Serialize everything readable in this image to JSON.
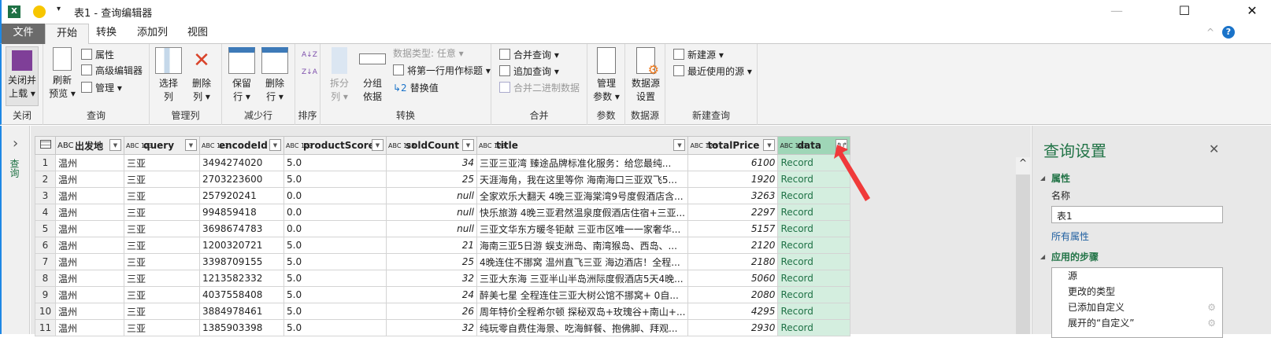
{
  "window": {
    "title": "表1 - 查询编辑器",
    "minimize": "—",
    "maximize": "☐",
    "close": "✕"
  },
  "tabs": [
    {
      "label": "文件"
    },
    {
      "label": "开始"
    },
    {
      "label": "转换"
    },
    {
      "label": "添加列"
    },
    {
      "label": "视图"
    }
  ],
  "ribbon": {
    "close_group": {
      "label": "关闭",
      "btn1": "关闭并",
      "btn2": "上载 ▾"
    },
    "query_group": {
      "label": "查询",
      "refresh1": "刷新",
      "refresh2": "预览 ▾",
      "properties": "属性",
      "advanced": "高级编辑器",
      "manage": "管理 ▾"
    },
    "cols_group": {
      "label": "管理列",
      "choose1": "选择",
      "choose2": "列",
      "remove1": "删除",
      "remove2": "列 ▾"
    },
    "rows_group": {
      "label": "减少行",
      "keep1": "保留",
      "keep2": "行 ▾",
      "remove1": "删除",
      "remove2": "行 ▾"
    },
    "sort_group": {
      "label": "排序",
      "asc": "A↓Z",
      "desc": "Z↓A"
    },
    "transform_group": {
      "label": "转换",
      "split1": "拆分",
      "split2": "列 ▾",
      "group1": "分组",
      "group2": "依据",
      "datatype": "数据类型: 任意 ▾",
      "firstrow": "将第一行用作标题 ▾",
      "replace": "替换值"
    },
    "combine_group": {
      "label": "合并",
      "merge": "合并查询 ▾",
      "append": "追加查询 ▾",
      "binary": "合并二进制数据"
    },
    "params_group": {
      "label": "参数",
      "manage1": "管理",
      "manage2": "参数 ▾"
    },
    "source_group": {
      "label": "数据源",
      "settings1": "数据源",
      "settings2": "设置"
    },
    "newquery_group": {
      "label": "新建查询",
      "newsource": "新建源 ▾",
      "recent": "最近使用的源 ▾"
    }
  },
  "leftnav": {
    "label": "查询",
    "expand": "›"
  },
  "table": {
    "columns": [
      {
        "name": "出发地",
        "type": "ABC"
      },
      {
        "name": "query",
        "type": "ABC 123"
      },
      {
        "name": "encodeId",
        "type": "ABC 123"
      },
      {
        "name": "productScore",
        "type": "ABC 123"
      },
      {
        "name": "soldCount",
        "type": "ABC 123"
      },
      {
        "name": "title",
        "type": "ABC 123"
      },
      {
        "name": "totalPrice",
        "type": "ABC 123"
      },
      {
        "name": "data",
        "type": "ABC 123"
      }
    ],
    "rows": [
      [
        "1",
        "温州",
        "三亚",
        "3494274020",
        "5.0",
        "34",
        "三亚三亚湾 臻途品牌标准化服务：给您最纯...",
        "6100",
        "Record"
      ],
      [
        "2",
        "温州",
        "三亚",
        "2703223600",
        "5.0",
        "25",
        "天涯海角，我在这里等你 海南海口三亚双飞5...",
        "1920",
        "Record"
      ],
      [
        "3",
        "温州",
        "三亚",
        "257920241",
        "0.0",
        "null",
        "全家欢乐大翻天 4晚三亚海棠湾9号度假酒店含...",
        "3263",
        "Record"
      ],
      [
        "4",
        "温州",
        "三亚",
        "994859418",
        "0.0",
        "null",
        "快乐旅游 4晚三亚君然温泉度假酒店住宿+三亚...",
        "2297",
        "Record"
      ],
      [
        "5",
        "温州",
        "三亚",
        "3698674783",
        "0.0",
        "null",
        "三亚文华东方暖冬钜献 三亚市区唯一一家奢华...",
        "5157",
        "Record"
      ],
      [
        "6",
        "温州",
        "三亚",
        "1200320721",
        "5.0",
        "21",
        "海南三亚5日游 蜈支洲岛、南湾猴岛、西岛、...",
        "2120",
        "Record"
      ],
      [
        "7",
        "温州",
        "三亚",
        "3398709155",
        "5.0",
        "25",
        "4晚连住不挪窝 温州直飞三亚 海边酒店！全程...",
        "2180",
        "Record"
      ],
      [
        "8",
        "温州",
        "三亚",
        "1213582332",
        "5.0",
        "32",
        "三亚大东海 三亚半山半岛洲际度假酒店5天4晚...",
        "5060",
        "Record"
      ],
      [
        "9",
        "温州",
        "三亚",
        "4037558408",
        "5.0",
        "24",
        "醉美七星 全程连住三亚大树公馆不挪窝+ 0自...",
        "2080",
        "Record"
      ],
      [
        "10",
        "温州",
        "三亚",
        "3884978461",
        "5.0",
        "26",
        "周年特价全程希尔顿 探秘双岛+玫瑰谷+南山+...",
        "4295",
        "Record"
      ],
      [
        "11",
        "温州",
        "三亚",
        "1385903398",
        "5.0",
        "32",
        "纯玩零自费住海景、吃海鲜餐、抱佛脚、拜观...",
        "2930",
        "Record"
      ]
    ]
  },
  "panel": {
    "title": "查询设置",
    "close": "✕",
    "properties_header": "属性",
    "name_label": "名称",
    "name_value": "表1",
    "all_properties": "所有属性",
    "steps_header": "应用的步骤",
    "steps": [
      "源",
      "更改的类型",
      "已添加自定义",
      "展开的“自定义”"
    ]
  },
  "colors": {
    "accent_green": "#217346",
    "data_column": "#d4eedf",
    "annotation_arrow": "#f03a3a"
  }
}
